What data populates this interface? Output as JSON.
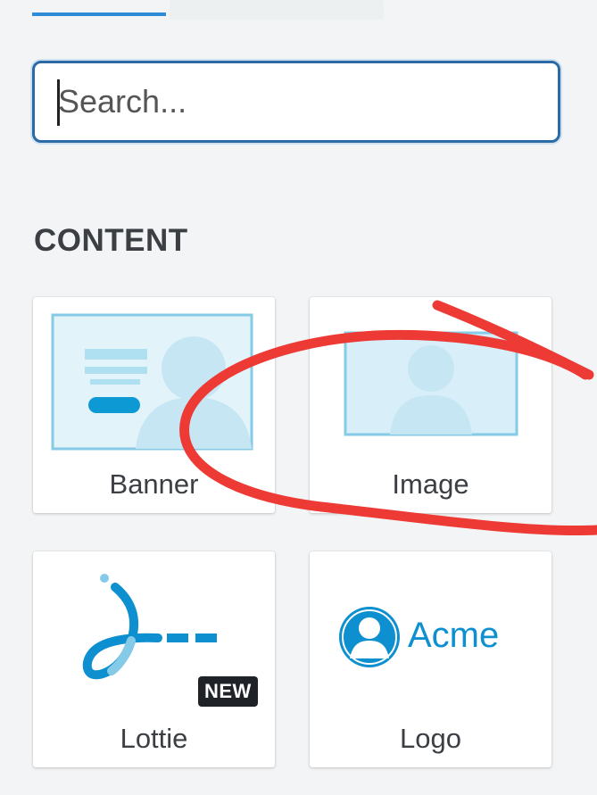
{
  "search": {
    "placeholder": "Search..."
  },
  "section": {
    "title": "CONTENT"
  },
  "widgets": [
    {
      "label": "Banner"
    },
    {
      "label": "Image"
    },
    {
      "label": "Lottie",
      "badge": "NEW"
    },
    {
      "label": "Logo",
      "logo_text": "Acme"
    }
  ],
  "colors": {
    "accent": "#2e8bd8",
    "illustration_light": "#c6e6f4",
    "illustration_mid": "#85cbe8",
    "brand_blue": "#0d8fd0",
    "annotation_red": "#ee3a34"
  },
  "icons": [
    "banner-icon",
    "image-icon",
    "lottie-icon",
    "acme-logo-icon"
  ]
}
